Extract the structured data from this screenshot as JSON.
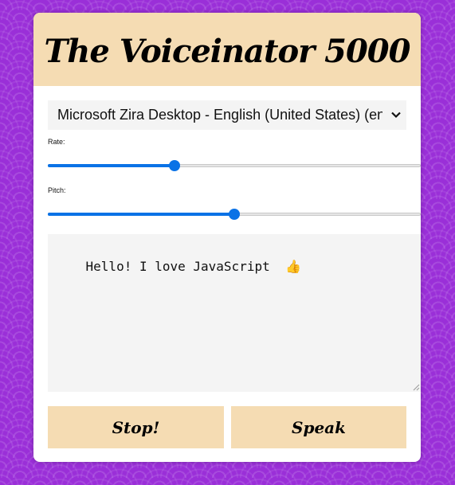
{
  "app": {
    "title": "The Voiceinator 5000"
  },
  "voice_select": {
    "selected": "Microsoft Zira Desktop - English (United States) (en-US)"
  },
  "rate": {
    "label": "Rate:",
    "value_fraction": 0.34
  },
  "pitch": {
    "label": "Pitch:",
    "value_fraction": 0.5
  },
  "message": {
    "value": "Hello! I love JavaScript  👍"
  },
  "buttons": {
    "stop_label": "Stop!",
    "speak_label": "Speak"
  },
  "colors": {
    "background": "#9a2fd8",
    "panel": "#f5dcb3",
    "accent": "#0a72e6"
  },
  "icons": {
    "select_arrow": "chevron-down-icon",
    "resize": "resize-grip-icon"
  }
}
